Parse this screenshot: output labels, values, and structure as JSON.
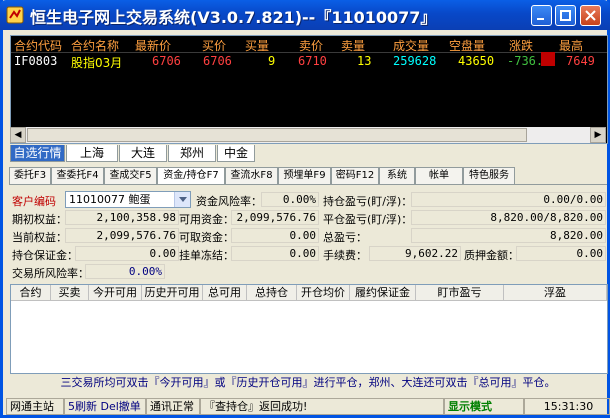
{
  "window": {
    "title": "恒生电子网上交易系统(V3.0.7.821)--『11010077』"
  },
  "quote_grid": {
    "columns": [
      "合约代码",
      "合约名称",
      "最新价",
      "买价",
      "买量",
      "卖价",
      "卖量",
      "成交量",
      "空盘量",
      "涨跌",
      "最高"
    ],
    "rows": [
      {
        "code": "IF0803",
        "name": "股指03月",
        "last": "6706",
        "bid": "6706",
        "bid_vol": "9",
        "ask": "6710",
        "ask_vol": "13",
        "volume": "259628",
        "open_interest": "43650",
        "change": "-736.2",
        "high": "7649"
      }
    ]
  },
  "market_tabs": [
    "自选行情",
    "上海",
    "大连",
    "郑州",
    "中金"
  ],
  "function_tabs": [
    "委托F3",
    "查委托F4",
    "查成交F5",
    "资金/持仓F7",
    "查流水F8",
    "预埋单F9",
    "密码F12",
    "系统",
    "帐单",
    "特色服务"
  ],
  "account": {
    "client_code_label": "客户编码",
    "client_code_value": "11010077  鲍蛋",
    "risk_label": "资金风险率：",
    "risk_value": "0.00%",
    "pos_pnl_label": "持仓盈亏(盯/浮)：",
    "pos_pnl_value": "0.00/0.00",
    "init_equity_label": "期初权益：",
    "init_equity_value": "2,100,358.98",
    "available_label": "可用资金：",
    "available_value": "2,099,576.76",
    "close_pnl_label": "平仓盈亏(盯/浮)：",
    "close_pnl_value": "8,820.00/8,820.00",
    "cur_equity_label": "当前权益：",
    "cur_equity_value": "2,099,576.76",
    "withdrawable_label": "可取资金：",
    "withdrawable_value": "0.00",
    "total_pnl_label": "总盈亏：",
    "total_pnl_value": "8,820.00",
    "margin_label": "持仓保证金：",
    "margin_value": "0.00",
    "frozen_label": "挂单冻结：",
    "frozen_value": "0.00",
    "fee_label": "手续费：",
    "fee_value": "9,602.22",
    "pledge_label": "质押金额：",
    "pledge_value": "0.00",
    "exch_risk_label": "交易所风险率：",
    "exch_risk_value": "0.00%"
  },
  "positions_table": {
    "columns": [
      "合约",
      "买卖",
      "今开可用",
      "历史开可用",
      "总可用",
      "总持仓",
      "开仓均价",
      "履约保证金",
      "盯市盈亏",
      "浮盈"
    ]
  },
  "hint": "三交易所均可双击『今开可用』或『历史开仓可用』进行平仓，郑州、大连还可双击『总可用』平仓。",
  "status_bar": {
    "site": "网通主站",
    "shortcut": "5刷新 Del撤单",
    "comm": "通讯正常",
    "message": "『查持仓』返回成功!",
    "mode": "显示模式",
    "time": "15:31:30"
  },
  "colors": {
    "header_text": "#ffa040",
    "up_red": "#ff4040",
    "code_white": "#ffffff",
    "price_yellow": "#ffff00",
    "volume_cyan": "#00ffff",
    "change_green": "#40c040",
    "accent_blue": "#316ac5",
    "mode_green": "#008000"
  }
}
